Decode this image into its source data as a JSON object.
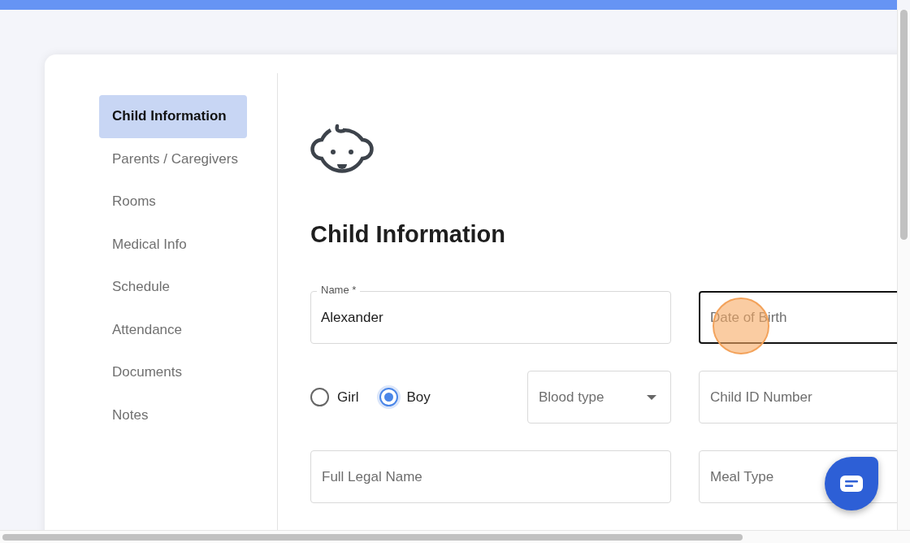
{
  "sidebar": {
    "items": [
      {
        "label": "Child Information",
        "selected": true
      },
      {
        "label": "Parents / Caregivers",
        "selected": false
      },
      {
        "label": "Rooms",
        "selected": false
      },
      {
        "label": "Medical Info",
        "selected": false
      },
      {
        "label": "Schedule",
        "selected": false
      },
      {
        "label": "Attendance",
        "selected": false
      },
      {
        "label": "Documents",
        "selected": false
      },
      {
        "label": "Notes",
        "selected": false
      }
    ]
  },
  "main": {
    "title": "Child Information",
    "name_field": {
      "label": "Name *",
      "value": "Alexander"
    },
    "date_of_birth_field": {
      "placeholder": "Date of Birth",
      "focused": true
    },
    "gender": [
      {
        "label": "Girl",
        "selected": false
      },
      {
        "label": "Boy",
        "selected": true
      }
    ],
    "blood_type_select": {
      "placeholder": "Blood type"
    },
    "child_id_field": {
      "placeholder": "Child ID Number",
      "focused": false
    },
    "full_legal_name_field": {
      "placeholder": "Full Legal Name",
      "focused": false
    },
    "meal_type_field": {
      "placeholder": "Meal Type",
      "focused": false
    }
  }
}
